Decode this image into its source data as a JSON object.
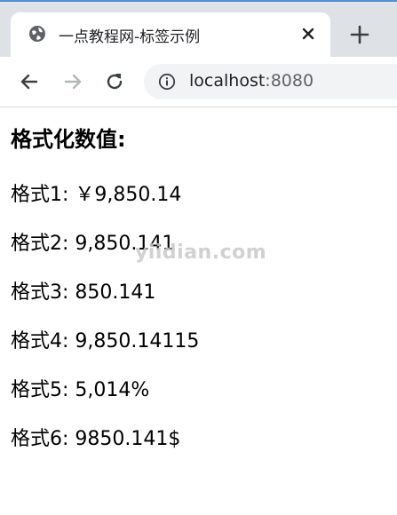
{
  "browser": {
    "tab_title": "一点教程网-标签示例",
    "url_host": "localhost",
    "url_port": ":8080"
  },
  "page": {
    "heading": "格式化数值:",
    "lines": [
      "格式1: ￥9,850.14",
      "格式2: 9,850.141",
      "格式3: 850.141",
      "格式4: 9,850.14115",
      "格式5: 5,014%",
      "格式6: 9850.141$"
    ]
  },
  "watermark": "yiidian.com",
  "icons": {
    "favicon": "globe-icon",
    "close": "close-icon",
    "new_tab": "plus-icon",
    "back": "back-arrow-icon",
    "forward": "forward-arrow-icon",
    "reload": "reload-icon",
    "site_info": "info-icon"
  }
}
